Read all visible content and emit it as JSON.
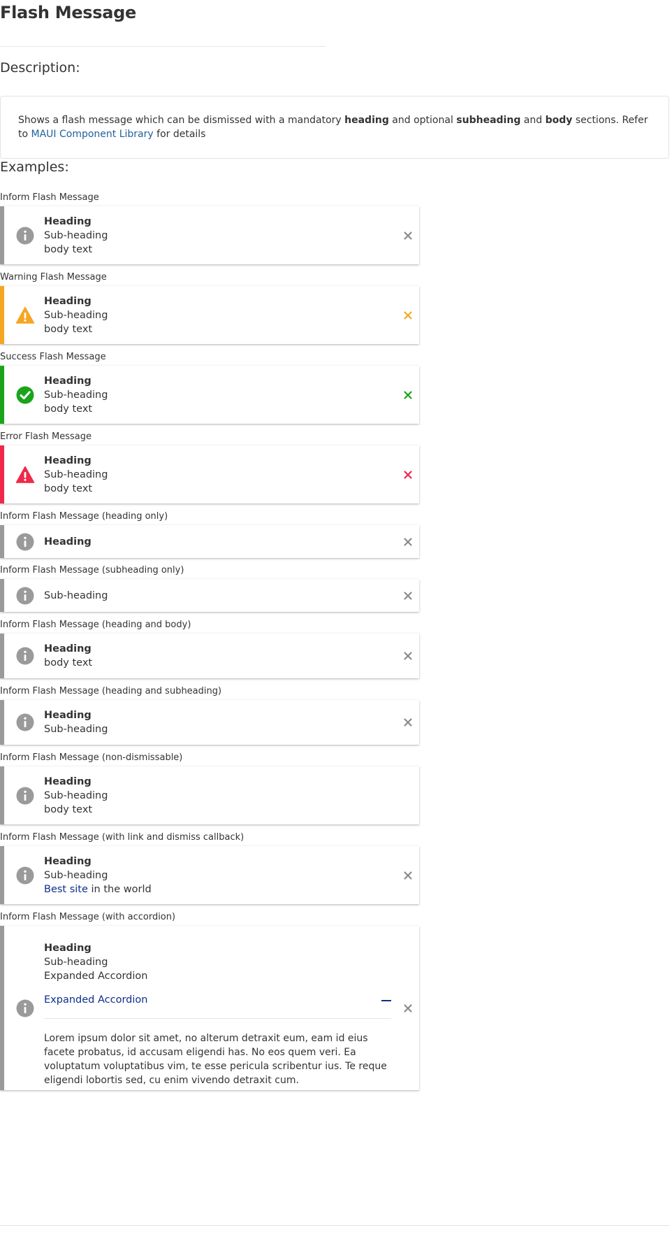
{
  "page": {
    "title": "Flash Message",
    "description_heading": "Description:",
    "examples_heading": "Examples:"
  },
  "description": {
    "t1": "Shows a flash message which can be dismissed with a mandatory ",
    "b1": "heading",
    "t2": " and optional ",
    "b2": "subheading",
    "t3": " and ",
    "b3": "body",
    "t4": " sections. Refer to ",
    "link": "MAUI Component Library",
    "t5": " for details"
  },
  "examples": [
    {
      "label": "Inform Flash Message",
      "type": "inform",
      "heading": "Heading",
      "subheading": "Sub-heading",
      "body": "body text"
    },
    {
      "label": "Warning Flash Message",
      "type": "warning",
      "heading": "Heading",
      "subheading": "Sub-heading",
      "body": "body text"
    },
    {
      "label": "Success Flash Message",
      "type": "success",
      "heading": "Heading",
      "subheading": "Sub-heading",
      "body": "body text"
    },
    {
      "label": "Error Flash Message",
      "type": "error",
      "heading": "Heading",
      "subheading": "Sub-heading",
      "body": "body text"
    },
    {
      "label": "Inform Flash Message (heading only)",
      "type": "inform",
      "heading": "Heading"
    },
    {
      "label": "Inform Flash Message (subheading only)",
      "type": "inform",
      "subheading": "Sub-heading"
    },
    {
      "label": "Inform Flash Message (heading and body)",
      "type": "inform",
      "heading": "Heading",
      "body": "body text"
    },
    {
      "label": "Inform Flash Message (heading and subheading)",
      "type": "inform",
      "heading": "Heading",
      "subheading": "Sub-heading"
    },
    {
      "label": "Inform Flash Message (non-dismissable)",
      "type": "inform",
      "heading": "Heading",
      "subheading": "Sub-heading",
      "body": "body text"
    },
    {
      "label": "Inform Flash Message (with link and dismiss callback)",
      "type": "inform",
      "heading": "Heading",
      "subheading": "Sub-heading",
      "body_link": "Best site",
      "body_rest": " in the world"
    },
    {
      "label": "Inform Flash Message (with accordion)",
      "type": "inform",
      "heading": "Heading",
      "subheading": "Sub-heading",
      "extra": "Expanded Accordion",
      "accordion_label": "Expanded Accordion",
      "accordion_body": "Lorem ipsum dolor sit amet, no alterum detraxit eum, eam id eius facete probatus, id accusam eligendi has. No eos quem veri. Ea voluptatum voluptatibus vim, te esse pericula scribentur ius. Te reque eligendi lobortis sed, cu enim vivendo detraxit cum."
    }
  ],
  "colors": {
    "inform": "#9a9a9a",
    "warning": "#f5a623",
    "success": "#1aa41a",
    "error": "#f02849",
    "link": "#1f5f9e",
    "accordion": "#0b2f8a"
  },
  "icons": {
    "inform": "info-icon",
    "warning": "warning-triangle-icon",
    "success": "check-circle-icon",
    "error": "error-triangle-icon",
    "close": "close-icon",
    "collapse": "minus-icon"
  }
}
